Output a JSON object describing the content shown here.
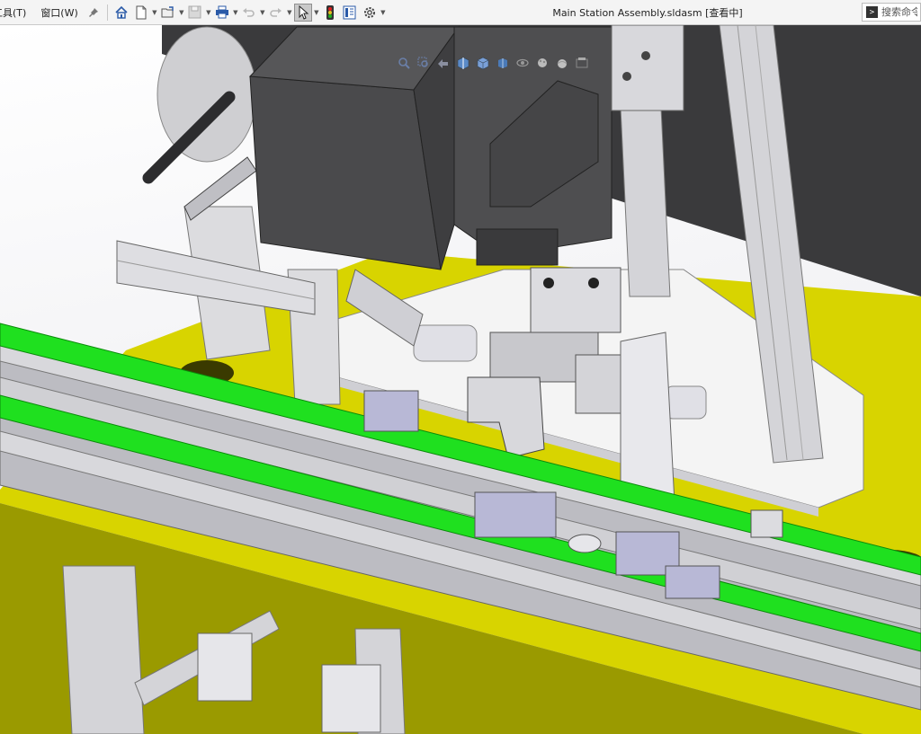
{
  "menu": {
    "tools_label": "工具(T)",
    "window_label": "窗口(W)"
  },
  "document": {
    "title": "Main Station Assembly.sldasm [查看中]"
  },
  "search": {
    "placeholder": "搜索命令"
  },
  "toolbar_icons": [
    "pin-icon",
    "home-icon",
    "new-document-icon",
    "open-folder-icon",
    "save-icon",
    "print-icon",
    "undo-icon",
    "redo-icon",
    "select-arrow-icon",
    "traffic-light-icon",
    "file-properties-icon",
    "options-gear-icon"
  ],
  "heads_up_icons": [
    "zoom-to-fit-icon",
    "zoom-area-icon",
    "previous-view-icon",
    "section-view-icon",
    "view-orientation-icon",
    "display-style-icon",
    "hide-show-items-icon",
    "edit-appearance-icon",
    "apply-scene-icon",
    "view-settings-icon"
  ],
  "colors": {
    "belt_green": "#1fe01f",
    "base_plate_yellow": "#d8d400",
    "aluminum_profile": "#cfcfd4",
    "motor_dark": "#4a4a4c",
    "cylinder_lavender": "#b8b8d6"
  }
}
